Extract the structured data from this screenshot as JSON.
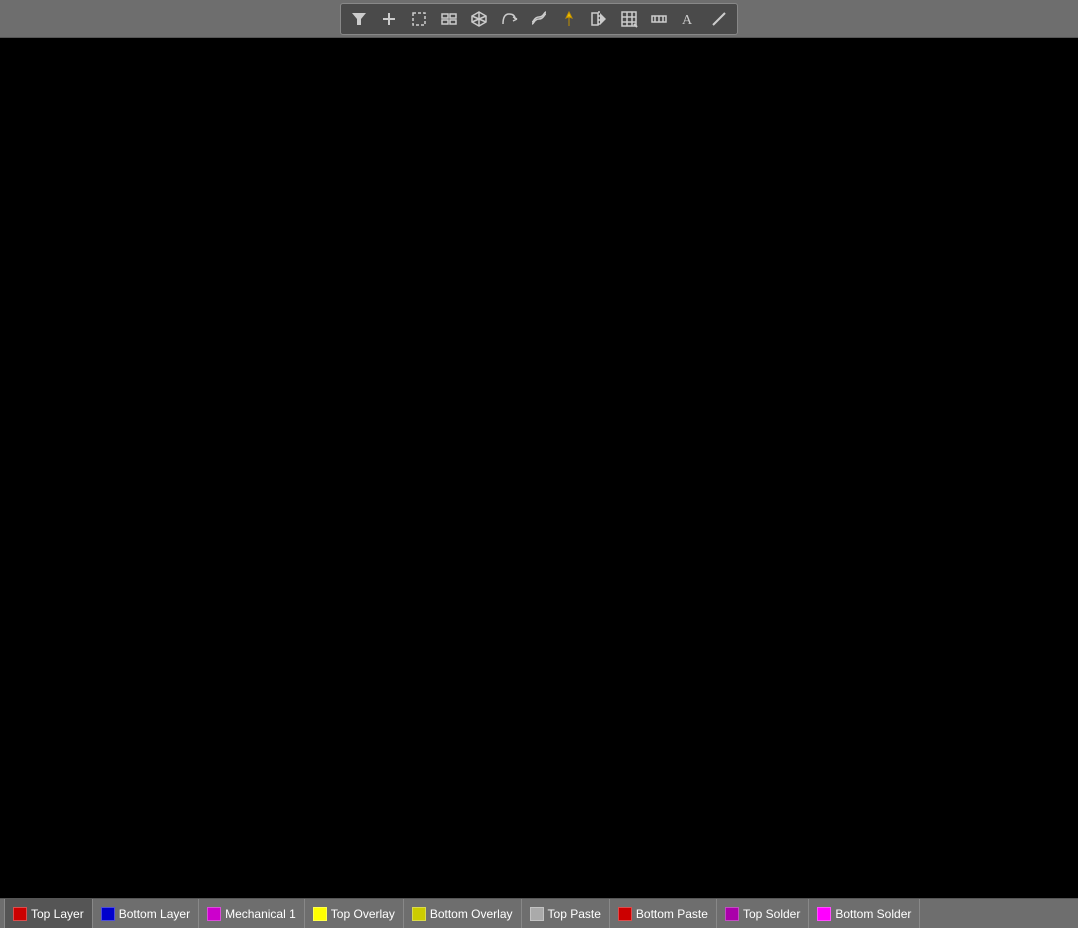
{
  "toolbar": {
    "buttons": [
      {
        "name": "filter-icon",
        "symbol": "▼",
        "label": "Filter"
      },
      {
        "name": "add-icon",
        "symbol": "+",
        "label": "Add"
      },
      {
        "name": "rectangle-icon",
        "symbol": "□",
        "label": "Rectangle"
      },
      {
        "name": "chart-icon",
        "symbol": "▦",
        "label": "Chart"
      },
      {
        "name": "3d-icon",
        "symbol": "◈",
        "label": "3D"
      },
      {
        "name": "route-icon",
        "symbol": "⌒",
        "label": "Route"
      },
      {
        "name": "track-icon",
        "symbol": "∿",
        "label": "Track"
      },
      {
        "name": "pin-icon",
        "symbol": "◆",
        "label": "Pin"
      },
      {
        "name": "mirror-icon",
        "symbol": "▣",
        "label": "Mirror"
      },
      {
        "name": "inspect-icon",
        "symbol": "⊠",
        "label": "Inspect"
      },
      {
        "name": "measure-icon",
        "symbol": "⊞",
        "label": "Measure"
      },
      {
        "name": "text-icon",
        "symbol": "A",
        "label": "Text"
      },
      {
        "name": "line-icon",
        "symbol": "/",
        "label": "Line"
      }
    ]
  },
  "layers": [
    {
      "name": "Top Layer",
      "color": "#cc0000",
      "active": true,
      "id": "top-layer"
    },
    {
      "name": "Bottom Layer",
      "color": "#0000cc",
      "active": false,
      "id": "bottom-layer"
    },
    {
      "name": "Mechanical 1",
      "color": "#cc00cc",
      "active": false,
      "id": "mechanical-1"
    },
    {
      "name": "Top Overlay",
      "color": "#ffff00",
      "active": false,
      "id": "top-overlay"
    },
    {
      "name": "Bottom Overlay",
      "color": "#cccc00",
      "active": false,
      "id": "bottom-overlay"
    },
    {
      "name": "Top Paste",
      "color": "#aaaaaa",
      "active": false,
      "id": "top-paste"
    },
    {
      "name": "Bottom Paste",
      "color": "#cc0000",
      "active": false,
      "id": "bottom-paste"
    },
    {
      "name": "Top Solder",
      "color": "#aa00aa",
      "active": false,
      "id": "top-solder"
    },
    {
      "name": "Bottom Solder",
      "color": "#ff00ff",
      "active": false,
      "id": "bottom-solder"
    }
  ]
}
